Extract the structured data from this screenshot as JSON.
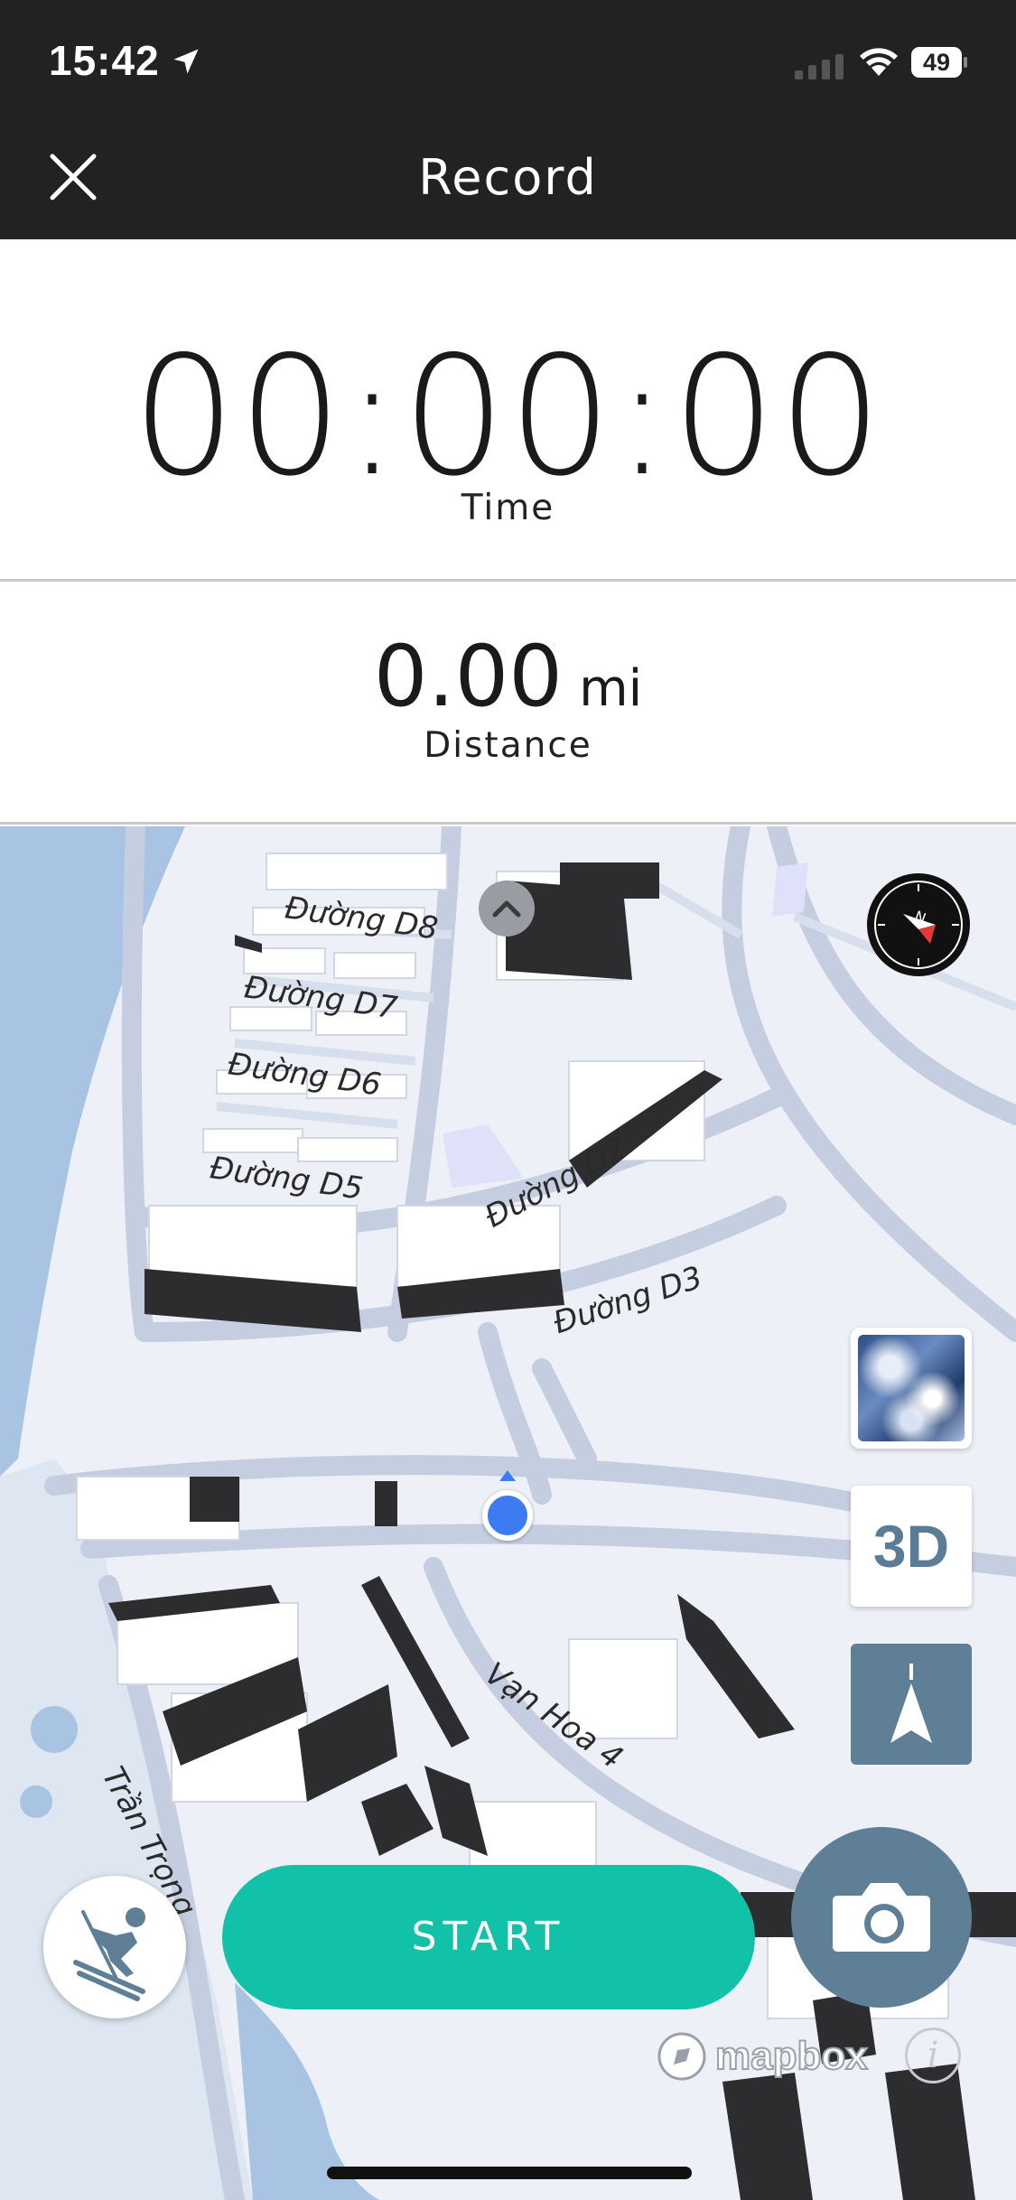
{
  "status_bar": {
    "time": "15:42",
    "battery": "49",
    "icons": [
      "location-arrow-icon",
      "cellular-signal-icon",
      "wifi-icon",
      "battery-icon"
    ]
  },
  "header": {
    "title": "Record",
    "close_icon": "close-icon"
  },
  "stats": {
    "time_value": "00:00:00",
    "time_label": "Time",
    "distance_value": "0.00",
    "distance_unit": "mi",
    "distance_label": "Distance"
  },
  "map": {
    "streets": [
      "Đường D8",
      "Đường D7",
      "Đường D6",
      "Đường D5",
      "Đường D2",
      "Đường D3",
      "Vạn Hoa 4",
      "Trần Trọng"
    ],
    "controls": {
      "compass_icon": "compass-icon",
      "terrain_icon": "terrain-layer-icon",
      "btn_3d": "3D",
      "nav_icon": "navigation-arrow-icon",
      "chevron_icon": "chevron-up-icon"
    },
    "attribution": "mapbox",
    "info": "i"
  },
  "bottom": {
    "activity_icon": "skier-icon",
    "start_label": "START",
    "camera_icon": "camera-icon"
  },
  "colors": {
    "header_bg": "#222222",
    "start_green": "#11c1a8",
    "control_blue": "#5f7f96",
    "location_blue": "#3d7cf0"
  }
}
